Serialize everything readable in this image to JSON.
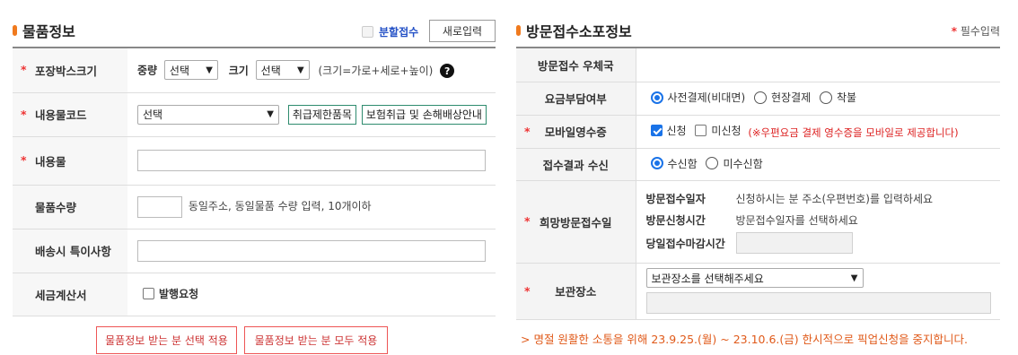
{
  "item_info": {
    "title": "물품정보",
    "split_label": "분할접수",
    "reset_button": "새로입력",
    "rows": {
      "box_size": {
        "label": "포장박스크기",
        "weight_label": "중량",
        "weight_value": "선택",
        "size_label": "크기",
        "size_value": "선택",
        "hint": "(크기=가로+세로+높이)",
        "help": "?"
      },
      "content_code": {
        "label": "내용물코드",
        "value": "선택",
        "btn_restricted": "취급제한품목",
        "btn_insurance": "보험취급 및 손해배상안내"
      },
      "content": {
        "label": "내용물",
        "value": ""
      },
      "quantity": {
        "label": "물품수량",
        "value": "",
        "hint": "동일주소, 동일물품 수량 입력, 10개이하"
      },
      "notes": {
        "label": "배송시 특이사항",
        "value": ""
      },
      "tax_invoice": {
        "label": "세금계산서",
        "option": "발행요청",
        "checked": false
      }
    },
    "apply_selected": "물품정보 받는 분 선택 적용",
    "apply_all": "물품정보 받는 분 모두 적용"
  },
  "visit_info": {
    "title": "방문접수소포정보",
    "required_note": "필수입력",
    "rows": {
      "post_office": {
        "label": "방문접수 우체국",
        "value": ""
      },
      "payment": {
        "label": "요금부담여부",
        "options": [
          "사전결제(비대면)",
          "현장결제",
          "착불"
        ],
        "selected": 0
      },
      "mobile_receipt": {
        "label": "모바일영수증",
        "apply": "신청",
        "apply_checked": true,
        "no_apply": "미신청",
        "no_apply_checked": false,
        "note": "(※우편요금 결제 영수증을 모바일로 제공합니다)"
      },
      "result_receive": {
        "label": "접수결과 수신",
        "options": [
          "수신함",
          "미수신함"
        ],
        "selected": 0
      },
      "desired_date": {
        "label": "희망방문접수일",
        "date_label": "방문접수일자",
        "date_value": "신청하시는 분 주소(우편번호)를 입력하세요",
        "time_label": "방문신청시간",
        "time_value": "방문접수일자를 선택하세요",
        "deadline_label": "당일접수마감시간",
        "deadline_value": ""
      },
      "storage": {
        "label": "보관장소",
        "value": "보관장소를 선택해주세요",
        "detail": ""
      }
    },
    "notice": "> 명절 원활한 소통을 위해 23.9.25.(월) ~ 23.10.6.(금) 한시적으로 픽업신청을 중지합니다."
  },
  "colors": {
    "accent_orange": "#f07a1e",
    "required_red": "#e33333",
    "link_blue": "#2451c6",
    "check_blue": "#1a73e8"
  }
}
